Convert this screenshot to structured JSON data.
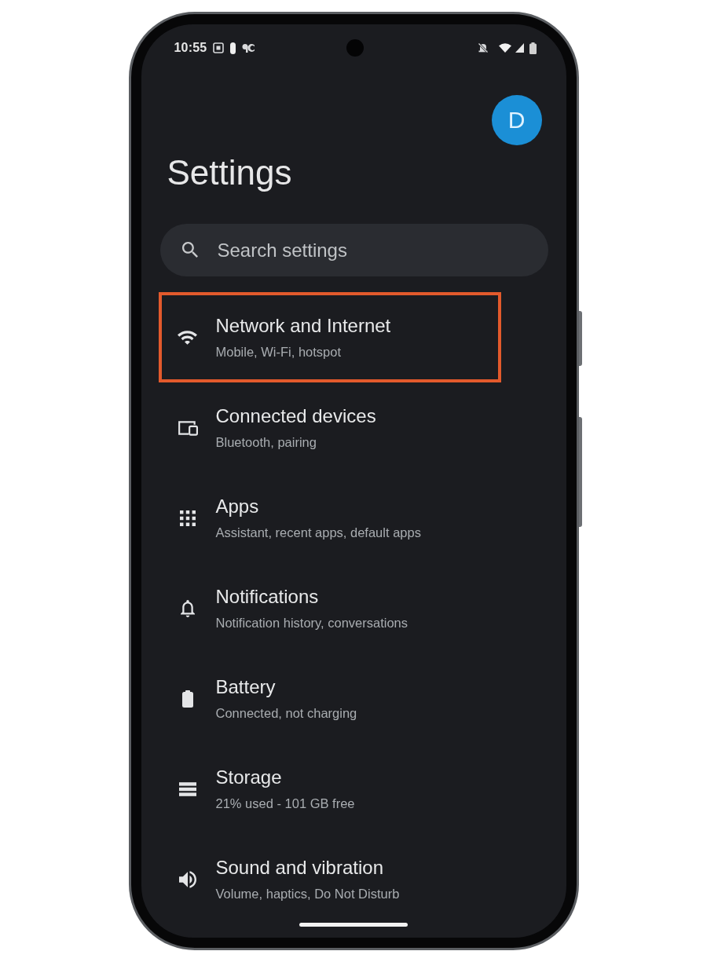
{
  "status_bar": {
    "time": "10:55"
  },
  "account": {
    "initial": "D"
  },
  "title": "Settings",
  "search": {
    "placeholder": "Search settings"
  },
  "items": [
    {
      "kind": "network",
      "title": "Network and Internet",
      "subtitle": "Mobile, Wi-Fi, hotspot",
      "highlighted": true
    },
    {
      "kind": "devices",
      "title": "Connected devices",
      "subtitle": "Bluetooth, pairing",
      "highlighted": false
    },
    {
      "kind": "apps",
      "title": "Apps",
      "subtitle": "Assistant, recent apps, default apps",
      "highlighted": false
    },
    {
      "kind": "notifications",
      "title": "Notifications",
      "subtitle": "Notification history, conversations",
      "highlighted": false
    },
    {
      "kind": "battery",
      "title": "Battery",
      "subtitle": "Connected, not charging",
      "highlighted": false
    },
    {
      "kind": "storage",
      "title": "Storage",
      "subtitle": "21% used - 101 GB free",
      "highlighted": false
    },
    {
      "kind": "sound",
      "title": "Sound and vibration",
      "subtitle": "Volume, haptics, Do Not Disturb",
      "highlighted": false
    }
  ]
}
